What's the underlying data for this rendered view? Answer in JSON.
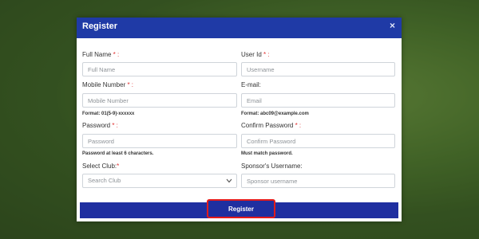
{
  "modal": {
    "title": "Register",
    "close_icon": "×"
  },
  "form": {
    "full_name": {
      "label": "Full Name",
      "required": " * :",
      "placeholder": "Full Name"
    },
    "user_id": {
      "label": "User Id",
      "required": " * :",
      "placeholder": "Username"
    },
    "mobile": {
      "label": "Mobile Number",
      "required": " * :",
      "placeholder": "Mobile Number",
      "hint": "Format: 01(5-9)-xxxxxx"
    },
    "email": {
      "label": "E-mail:",
      "placeholder": "Email",
      "hint": "Format: abc09@example.com"
    },
    "password": {
      "label": "Password",
      "required": " * :",
      "placeholder": "Password",
      "hint": "Password at least 6 characters."
    },
    "confirm_password": {
      "label": "Confirm Password",
      "required": " * :",
      "placeholder": "Confirm Password",
      "hint": "Must match password."
    },
    "club": {
      "label": "Select Club:",
      "required": "*",
      "selected": "Search Club"
    },
    "sponsor": {
      "label": "Sponsor's Username:",
      "placeholder": "Sponsor username"
    }
  },
  "register_button": "Register",
  "colors": {
    "header": "#1f3aa6",
    "button": "#1f2fa0",
    "required": "#e03030",
    "highlight": "#e41b1b"
  }
}
